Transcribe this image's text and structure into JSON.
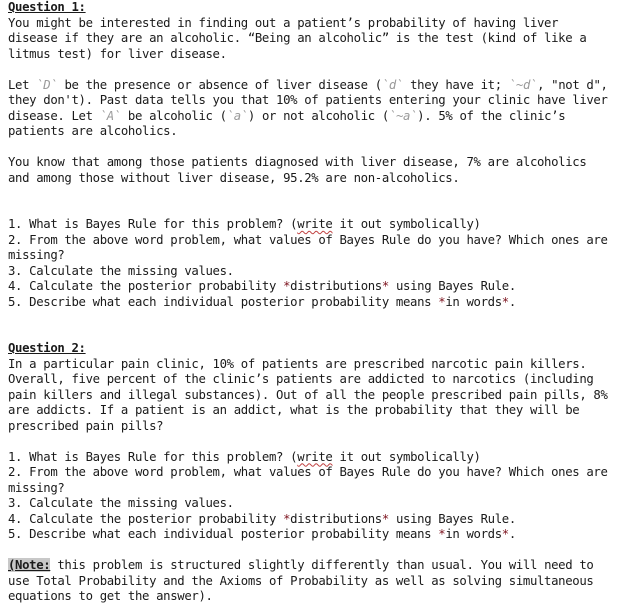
{
  "question1": {
    "title": "Question 1:",
    "intro_lines": [
      "You might be interested in finding out a patient’s probability of having liver",
      "disease if they are an alcoholic. “Being an alcoholic” is the test (kind of like a",
      "litmus test) for liver disease."
    ],
    "def_line1": {
      "a": "Let ",
      "b": "`D`",
      "c": " be the presence or absence of liver disease (",
      "d": "`d`",
      "e": " they have it; ",
      "f": "`~d`",
      "g": ", \"not d\","
    },
    "def_line2": "they don't). Past data tells you that 10% of patients entering your clinic have liver",
    "def_line3": {
      "a": "disease. Let ",
      "b": "`A`",
      "c": " be alcoholic (",
      "d": "`a`",
      "e": ") or not alcoholic (",
      "f": "`~a`",
      "g": "). 5% of the clinic’s"
    },
    "def_line4": "patients are alcoholics.",
    "known_lines": [
      "You know that among those patients diagnosed with liver disease, 7% are alcoholics",
      "and among those without liver disease, 95.2% are non-alcoholics."
    ],
    "tasks": {
      "t1": {
        "a": "1. What is Bayes Rule for this problem? (",
        "b": "write",
        "c": " it out symbolically)"
      },
      "t2a": "2. From the above word problem, what values of Bayes Rule do you have? Which ones are",
      "t2b": "missing?",
      "t3": "3. Calculate the missing values.",
      "t4": {
        "a": "4. Calculate the posterior probability ",
        "s1": "*",
        "b": "distributions",
        "s2": "*",
        "c": " using Bayes Rule."
      },
      "t5": {
        "a": "5. Describe what each individual posterior probability means ",
        "s1": "*",
        "b": "in words",
        "s2": "*",
        "c": "."
      }
    }
  },
  "question2": {
    "title": "Question 2:",
    "intro_lines": [
      "In a particular pain clinic, 10% of patients are prescribed narcotic pain killers.",
      "Overall, five percent of the clinic’s patients are addicted to narcotics (including",
      "pain killers and illegal substances). Out of all the people prescribed pain pills, 8%",
      "are addicts. If a patient is an addict, what is the probability that they will be",
      "prescribed pain pills?"
    ],
    "tasks": {
      "t1": {
        "a": "1. What is Bayes Rule for this problem? (",
        "b": "write",
        "c": " it out symbolically)"
      },
      "t2a": "2. From the above word problem, what values of Bayes Rule do you have? Which ones are",
      "t2b": "missing?",
      "t3": "3. Calculate the missing values.",
      "t4": {
        "a": "4. Calculate the posterior probability ",
        "s1": "*",
        "b": "distributions",
        "s2": "*",
        "c": " using Bayes Rule."
      },
      "t5": {
        "a": "5. Describe what each individual posterior probability means ",
        "s1": "*",
        "b": "in words",
        "s2": "*",
        "c": "."
      }
    },
    "note": {
      "label": "(Note:",
      "line1": " this problem is structured slightly differently than usual. You will need to",
      "line2": "use Total Probability and the Axioms of Probability as well as solving simultaneous",
      "line3": "equations to get the answer)."
    }
  },
  "colors": {
    "text": "#1a1a1a",
    "code_span": "#9a9a9a",
    "emphasis_star": "#7a0f1a",
    "spellcheck_underline": "#c04040",
    "note_highlight": "#c8c8c8"
  }
}
